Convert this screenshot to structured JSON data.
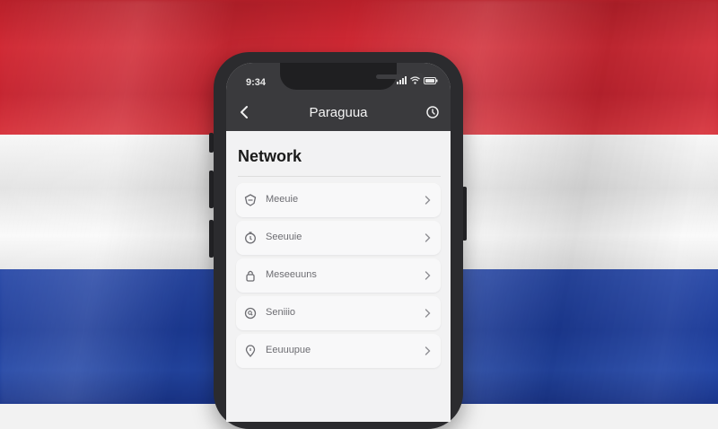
{
  "status_bar": {
    "time": "9:34",
    "icons": [
      "signal-icon",
      "wifi-icon",
      "battery-icon"
    ]
  },
  "nav": {
    "title": "Paraguua",
    "back_icon": "back-arrow-icon",
    "right_icon": "settings-icon"
  },
  "page": {
    "title": "Network"
  },
  "items": [
    {
      "label": "Meeuie",
      "icon": "shield-icon"
    },
    {
      "label": "Seeuuie",
      "icon": "clock-icon"
    },
    {
      "label": "Meseeuuns",
      "icon": "lock-icon"
    },
    {
      "label": "Seniiio",
      "icon": "search-icon"
    },
    {
      "label": "Eeuuupue",
      "icon": "location-icon"
    }
  ],
  "colors": {
    "flag_red": "#d12a35",
    "flag_white": "#f2f2f2",
    "flag_blue": "#1d3c99",
    "header_bg": "#3a3a3d",
    "screen_bg": "#f2f2f3"
  }
}
